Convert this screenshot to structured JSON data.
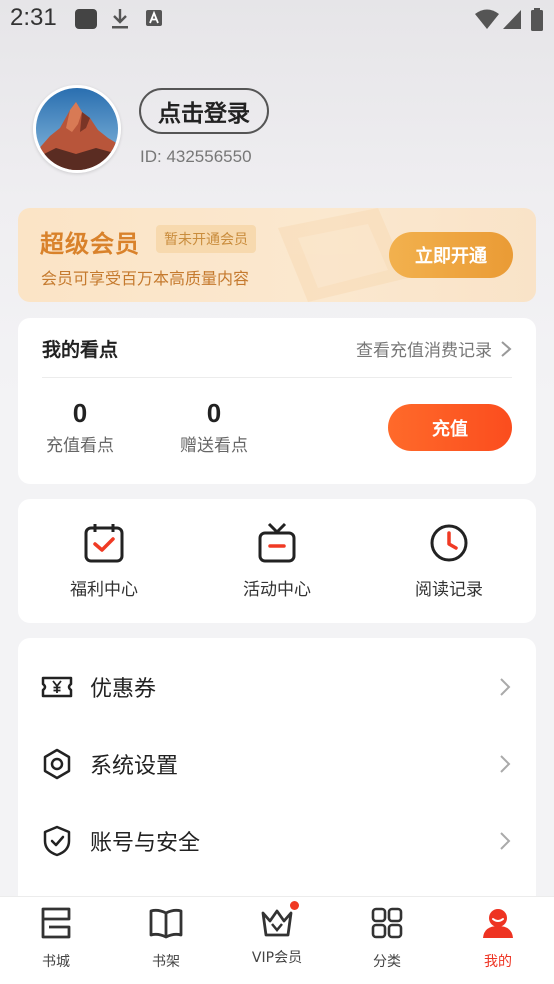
{
  "status_bar": {
    "time": "2:31",
    "icons": [
      "app-square-icon",
      "download-icon",
      "text-a-icon",
      "wifi-icon",
      "signal-icon",
      "battery-icon"
    ]
  },
  "profile": {
    "login_label": "点击登录",
    "user_id": "ID: 432556550",
    "avatar_desc": "mountain-avatar"
  },
  "vip_banner": {
    "title": "超级会员",
    "tag": "暂未开通会员",
    "description": "会员可享受百万本高质量内容",
    "button": "立即开通"
  },
  "points": {
    "title": "我的看点",
    "record_link": "查看充值消费记录",
    "stats": [
      {
        "value": "0",
        "label": "充值看点"
      },
      {
        "value": "0",
        "label": "赠送看点"
      }
    ],
    "recharge_button": "充值"
  },
  "features": [
    {
      "label": "福利中心",
      "icon": "calendar-check-icon"
    },
    {
      "label": "活动中心",
      "icon": "gift-box-icon"
    },
    {
      "label": "阅读记录",
      "icon": "clock-icon"
    }
  ],
  "menu": [
    {
      "label": "优惠券",
      "icon": "coupon-icon"
    },
    {
      "label": "系统设置",
      "icon": "settings-gear-icon"
    },
    {
      "label": "账号与安全",
      "icon": "shield-check-icon"
    }
  ],
  "bottom_nav": [
    {
      "label": "书城",
      "icon": "bookstore-icon",
      "active": false
    },
    {
      "label": "书架",
      "icon": "bookshelf-icon",
      "active": false
    },
    {
      "label": "VIP会员",
      "icon": "vip-crown-icon",
      "active": false,
      "badge": true
    },
    {
      "label": "分类",
      "icon": "category-grid-icon",
      "active": false
    },
    {
      "label": "我的",
      "icon": "profile-icon",
      "active": true
    }
  ],
  "colors": {
    "accent": "#ee3322",
    "vip_gold": "#d9822b",
    "recharge_orange": "#fb4d1e",
    "vip_button": "#f2b14e"
  }
}
